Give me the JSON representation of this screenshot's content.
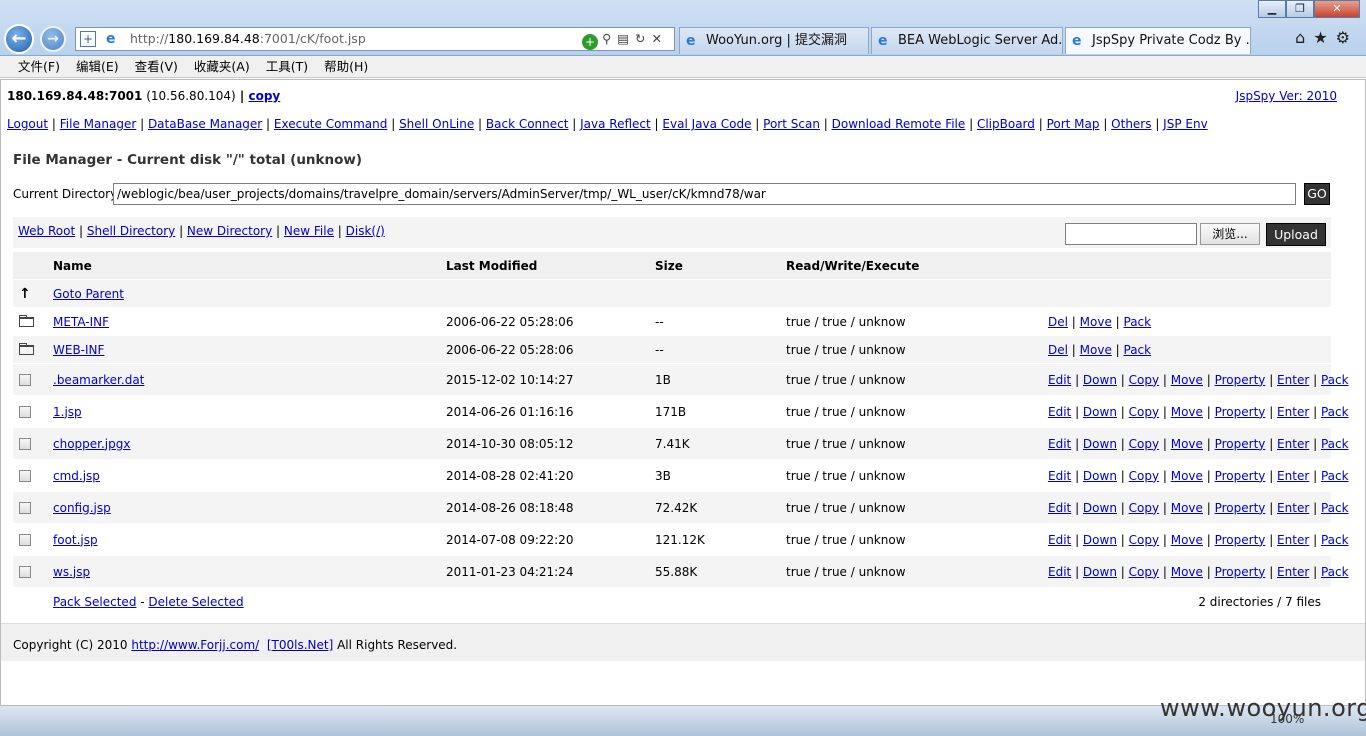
{
  "browser": {
    "url_prefix": "http://",
    "url_host": "180.169.84.48",
    "url_rest": ":7001/cK/foot.jsp",
    "tabs": [
      {
        "label": "WooYun.org | 提交漏洞"
      },
      {
        "label": "BEA WebLogic Server Ad..."
      },
      {
        "label": "JspSpy Private Codz By ..."
      }
    ],
    "menu": [
      "文件(F)",
      "编辑(E)",
      "查看(V)",
      "收藏夹(A)",
      "工具(T)",
      "帮助(H)"
    ],
    "zoom": "100%"
  },
  "header": {
    "host": "180.169.84.48:7001",
    "ip": "(10.56.80.104)",
    "sep": " | ",
    "copy_link": "copy",
    "version": "JspSpy Ver: 2010"
  },
  "nav": [
    "Logout",
    "File Manager",
    "DataBase Manager",
    "Execute Command",
    "Shell OnLine",
    "Back Connect",
    "Java Reflect",
    "Eval Java Code",
    "Port Scan",
    "Download Remote File",
    "ClipBoard",
    "Port Map",
    "Others",
    "JSP Env"
  ],
  "file_manager": {
    "title": "File Manager - Current disk \"/\" total (unknow)",
    "current_dir_label": "Current Directory",
    "current_dir": "/weblogic/bea/user_projects/domains/travelpre_domain/servers/AdminServer/tmp/_WL_user/cK/kmnd78/war",
    "go_label": "GO",
    "quick_links": [
      "Web Root",
      "Shell Directory",
      "New Directory",
      "New File",
      "Disk(/)"
    ],
    "browse_label": "浏览...",
    "upload_label": "Upload",
    "columns": {
      "name": "Name",
      "modified": "Last Modified",
      "size": "Size",
      "rwx": "Read/Write/Execute"
    },
    "goto_parent": "Goto Parent",
    "directories": [
      {
        "name": "META-INF",
        "modified": "2006-06-22 05:28:06",
        "size": "--",
        "rwx": "true / true / unknow",
        "actions": [
          "Del",
          "Move",
          "Pack"
        ]
      },
      {
        "name": "WEB-INF",
        "modified": "2006-06-22 05:28:06",
        "size": "--",
        "rwx": "true / true / unknow",
        "actions": [
          "Del",
          "Move",
          "Pack"
        ]
      }
    ],
    "files": [
      {
        "name": ".beamarker.dat",
        "modified": "2015-12-02 10:14:27",
        "size": "1B",
        "rwx": "true / true / unknow"
      },
      {
        "name": "1.jsp",
        "modified": "2014-06-26 01:16:16",
        "size": "171B",
        "rwx": "true / true / unknow"
      },
      {
        "name": "chopper.jpgx",
        "modified": "2014-10-30 08:05:12",
        "size": "7.41K",
        "rwx": "true / true / unknow"
      },
      {
        "name": "cmd.jsp",
        "modified": "2014-08-28 02:41:20",
        "size": "3B",
        "rwx": "true / true / unknow"
      },
      {
        "name": "config.jsp",
        "modified": "2014-08-26 08:18:48",
        "size": "72.42K",
        "rwx": "true / true / unknow"
      },
      {
        "name": "foot.jsp",
        "modified": "2014-07-08 09:22:20",
        "size": "121.12K",
        "rwx": "true / true / unknow"
      },
      {
        "name": "ws.jsp",
        "modified": "2011-01-23 04:21:24",
        "size": "55.88K",
        "rwx": "true / true / unknow"
      }
    ],
    "file_actions": [
      "Edit",
      "Down",
      "Copy",
      "Move",
      "Property",
      "Enter",
      "Pack"
    ],
    "pack_selected": "Pack Selected",
    "dash": " - ",
    "delete_selected": "Delete Selected",
    "summary": "2 directories / 7 files"
  },
  "footer": {
    "copyright": "Copyright (C) 2010 ",
    "link1": "http://www.Forjj.com/",
    "link2": "[T00ls.Net]",
    "rights": " All Rights Reserved."
  },
  "watermark": "www.wooyun.org"
}
